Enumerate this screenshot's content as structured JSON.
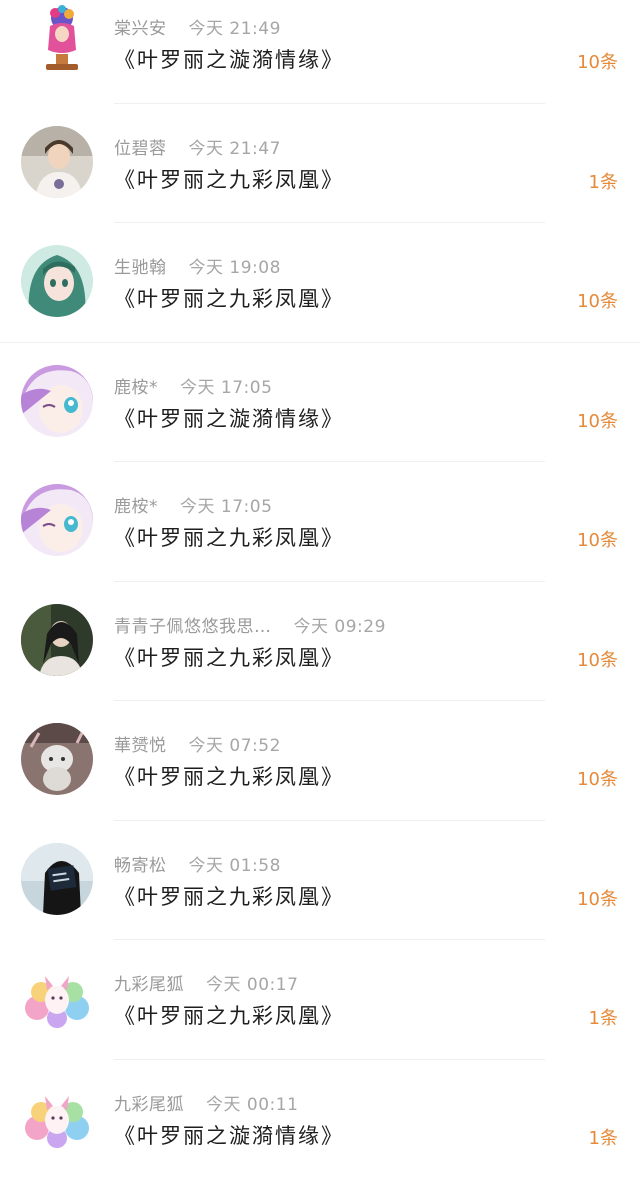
{
  "items": [
    {
      "name": "棠兴安",
      "time": "今天 21:49",
      "title": "《叶罗丽之漩漪情缘》",
      "count": "10条",
      "avatar": "figure-icon"
    },
    {
      "name": "位碧蓉",
      "time": "今天 21:47",
      "title": "《叶罗丽之九彩凤凰》",
      "count": "1条",
      "avatar": "person-icon"
    },
    {
      "name": "生驰翰",
      "time": "今天 19:08",
      "title": "《叶罗丽之九彩凤凰》",
      "count": "10条",
      "avatar": "anime-green-icon"
    },
    {
      "name": "鹿桉*",
      "time": "今天 17:05",
      "title": "《叶罗丽之漩漪情缘》",
      "count": "10条",
      "avatar": "anime-pink-icon"
    },
    {
      "name": "鹿桉*",
      "time": "今天 17:05",
      "title": "《叶罗丽之九彩凤凰》",
      "count": "10条",
      "avatar": "anime-pink-icon"
    },
    {
      "name": "青青子佩悠悠我思…",
      "time": "今天 09:29",
      "title": "《叶罗丽之九彩凤凰》",
      "count": "10条",
      "avatar": "person-dark-icon"
    },
    {
      "name": "華赟悦",
      "time": "今天 07:52",
      "title": "《叶罗丽之九彩凤凰》",
      "count": "10条",
      "avatar": "plush-icon"
    },
    {
      "name": "畅寄松",
      "time": "今天 01:58",
      "title": "《叶罗丽之九彩凤凰》",
      "count": "10条",
      "avatar": "person-card-icon"
    },
    {
      "name": "九彩尾狐",
      "time": "今天 00:17",
      "title": "《叶罗丽之九彩凤凰》",
      "count": "1条",
      "avatar": "fox-icon"
    },
    {
      "name": "九彩尾狐",
      "time": "今天 00:11",
      "title": "《叶罗丽之漩漪情缘》",
      "count": "1条",
      "avatar": "fox-icon"
    }
  ]
}
